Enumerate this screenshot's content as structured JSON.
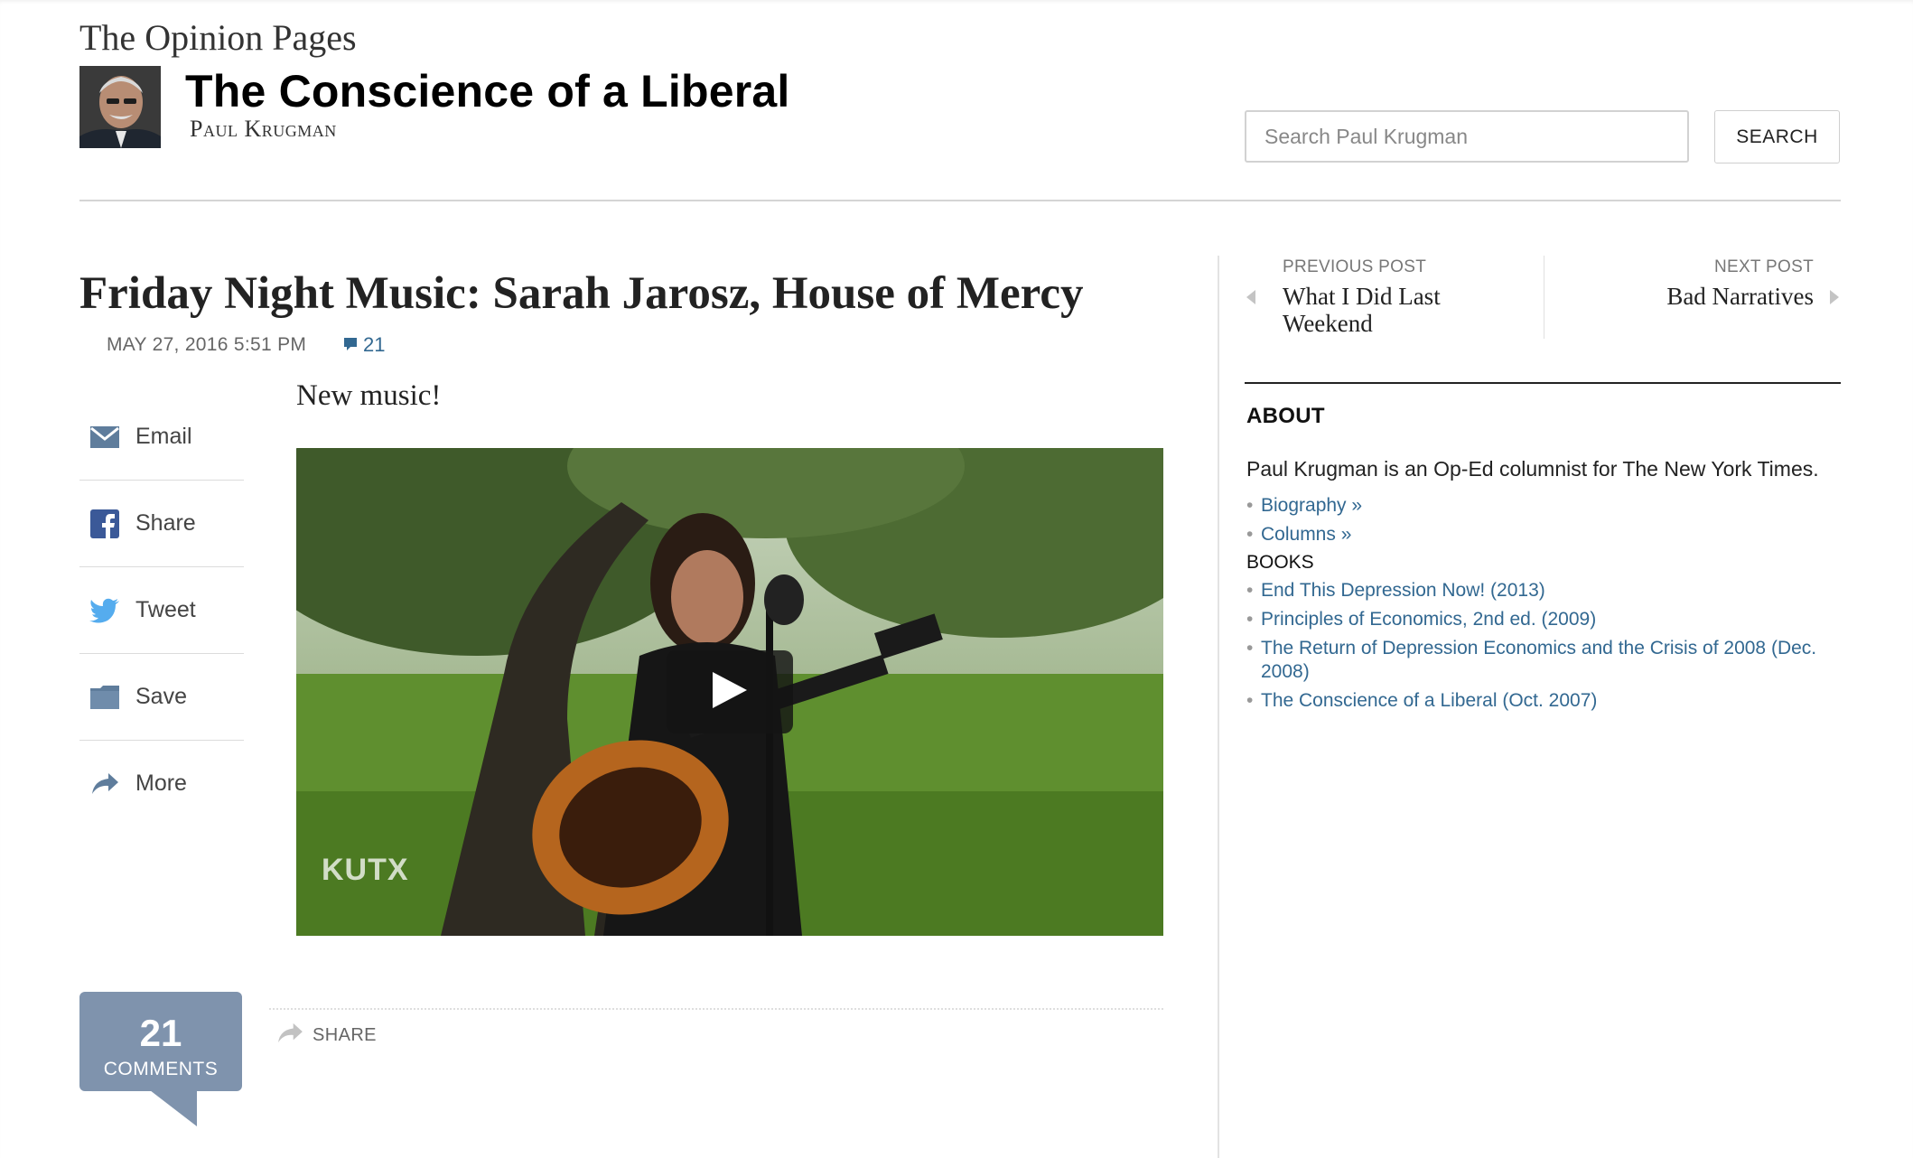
{
  "header": {
    "section_name": "The Opinion Pages",
    "blog_title": "The Conscience of a Liberal",
    "byline": "Paul Krugman",
    "search_placeholder": "Search Paul Krugman",
    "search_button": "SEARCH"
  },
  "article": {
    "headline": "Friday Night Music: Sarah Jarosz, House of Mercy",
    "dateline": "MAY 27, 2016 5:51 PM",
    "comment_count": "21",
    "body": "New music!",
    "video_watermark": "KUTX",
    "share_tools": [
      {
        "label": "Email",
        "icon": "envelope-icon"
      },
      {
        "label": "Share",
        "icon": "facebook-icon"
      },
      {
        "label": "Tweet",
        "icon": "twitter-icon"
      },
      {
        "label": "Save",
        "icon": "folder-icon"
      },
      {
        "label": "More",
        "icon": "share-arrow-icon"
      }
    ],
    "comments_box": {
      "count": "21",
      "label": "COMMENTS"
    },
    "bottom_share": "SHARE"
  },
  "sidebar": {
    "previous_post": {
      "kicker": "PREVIOUS POST",
      "title": "What I Did Last Weekend"
    },
    "next_post": {
      "kicker": "NEXT POST",
      "title": "Bad Narratives"
    },
    "about_heading": "ABOUT",
    "about_text": "Paul Krugman is an Op-Ed columnist for The New York Times.",
    "about_links": [
      "Biography »",
      "Columns »"
    ],
    "books_heading": "BOOKS",
    "books": [
      "End This Depression Now! (2013)",
      "Principles of Economics, 2nd ed. (2009)",
      "The Return of Depression Economics and the Crisis of 2008 (Dec. 2008)",
      "The Conscience of a Liberal (Oct. 2007)"
    ]
  },
  "colors": {
    "link": "#326891",
    "comments_box": "#7f93ad",
    "facebook": "#3b5998",
    "twitter": "#55acee"
  }
}
